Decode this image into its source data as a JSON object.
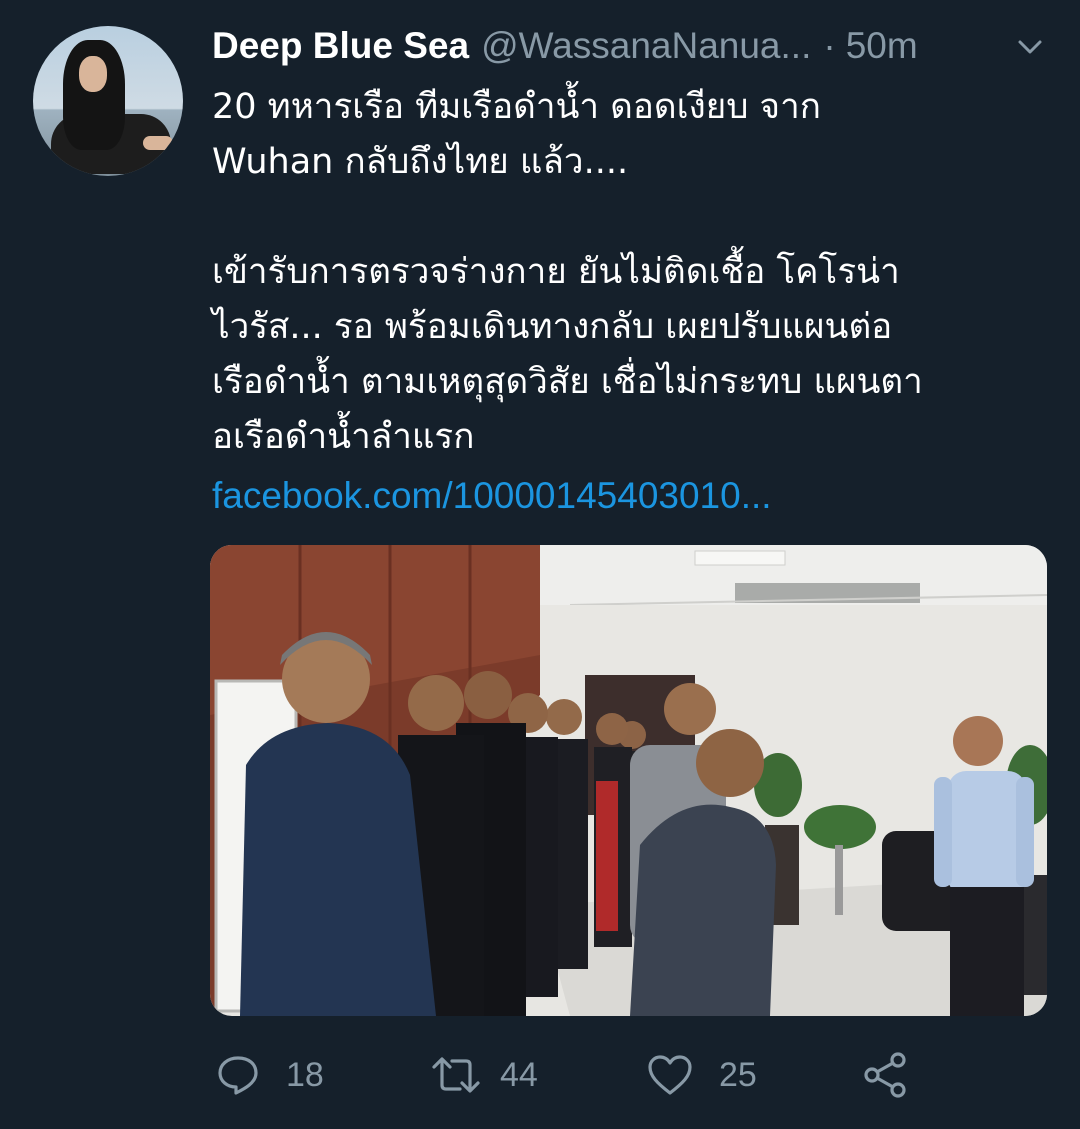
{
  "tweet": {
    "author_name": "Deep Blue Sea",
    "author_handle": "@WassanaNanua...",
    "separator": "·",
    "timestamp": "50m",
    "text_lines": [
      "20 ทหารเรือ ทีมเรือดำน้ำ  ดอดเงียบ จาก",
      "Wuhan กลับถึงไทย แล้ว....",
      "",
      "เข้ารับการตรวจร่างกาย ยันไม่ติดเชื้อ โคโรน่า",
      "ไวรัส... รอ พร้อมเดินทางกลับ เผยปรับแผนต่อ",
      "เรือดำน้ำ ตามเหตุสุดวิสัย เชื่อไม่กระทบ แผนตา",
      "อเรือดำน้ำลำแรก"
    ],
    "link_text": "facebook.com/10000145403010..."
  },
  "actions": {
    "reply_count": "18",
    "retweet_count": "44",
    "like_count": "25"
  },
  "icons": {
    "more": "chevron-down-icon",
    "reply": "reply-icon",
    "retweet": "retweet-icon",
    "like": "heart-icon",
    "share": "share-icon"
  },
  "colors": {
    "background": "#15202b",
    "text_primary": "#ffffff",
    "text_secondary": "#8899a6",
    "link": "#1b95e0"
  }
}
